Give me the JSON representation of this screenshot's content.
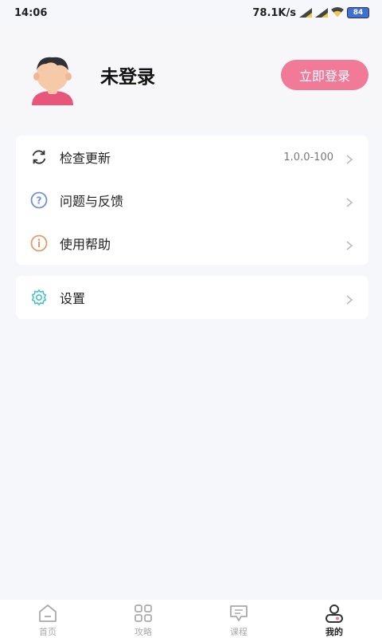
{
  "status_bar": {
    "time": "14:06",
    "network_speed": "78.1K/s",
    "battery": "84",
    "icons": [
      "signal-icon",
      "signal-icon",
      "wifi-icon",
      "battery-icon"
    ]
  },
  "profile": {
    "name": "未登录",
    "login_button": "立即登录",
    "avatar_icon": "avatar-icon"
  },
  "menu": {
    "group1": [
      {
        "icon": "refresh-icon",
        "label": "检查更新",
        "value": "1.0.0-100"
      },
      {
        "icon": "question-icon",
        "label": "问题与反馈"
      },
      {
        "icon": "info-icon",
        "label": "使用帮助"
      }
    ],
    "group2": [
      {
        "icon": "gear-icon",
        "label": "设置"
      }
    ]
  },
  "tabbar": {
    "tabs": [
      {
        "icon": "home-icon",
        "label": "首页"
      },
      {
        "icon": "grid-icon",
        "label": "攻略"
      },
      {
        "icon": "course-icon",
        "label": "课程"
      },
      {
        "icon": "user-icon",
        "label": "我的",
        "active": true
      }
    ]
  },
  "colors": {
    "accent": "#f27a99",
    "background": "#f6f7fb",
    "refresh": "#333333",
    "question": "#6f8fd8",
    "info": "#e39a6a",
    "gear": "#3fc6c0"
  }
}
